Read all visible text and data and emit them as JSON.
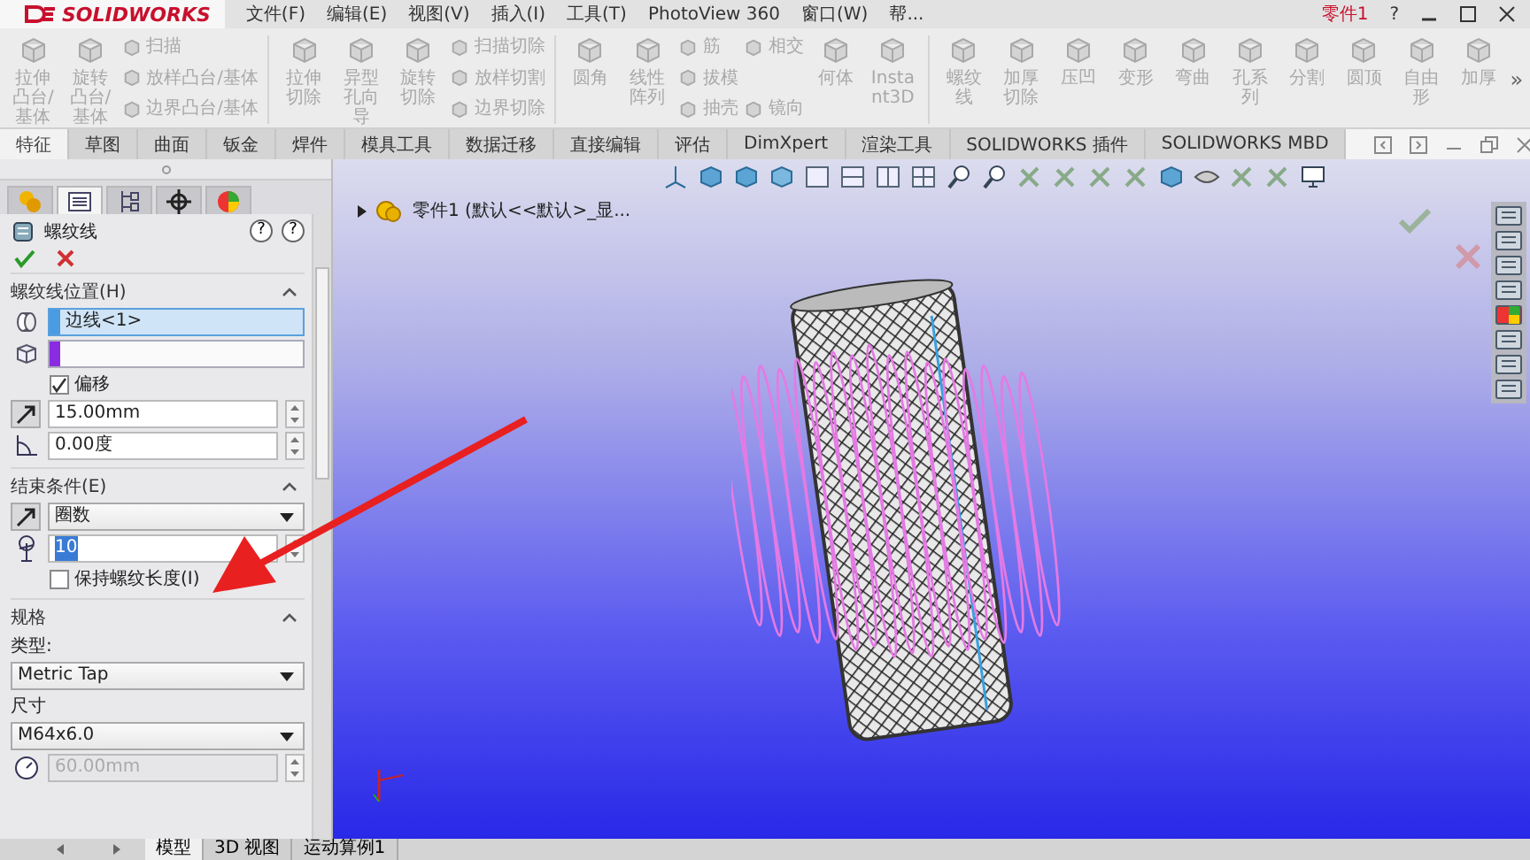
{
  "app": {
    "logo": "SOLIDWORKS",
    "menus": [
      "文件(F)",
      "编辑(E)",
      "视图(V)",
      "插入(I)",
      "工具(T)",
      "PhotoView 360",
      "窗口(W)",
      "帮..."
    ],
    "document": "零件1",
    "help": "?"
  },
  "ribbon": {
    "disabled": true,
    "groups": [
      [
        {
          "kind": "large",
          "label": "拉伸凸台/基体"
        },
        {
          "kind": "large",
          "label": "旋转凸台/基体"
        },
        {
          "kind": "stack",
          "items": [
            "扫描",
            "放样凸台/基体",
            "边界凸台/基体"
          ]
        }
      ],
      [
        {
          "kind": "large",
          "label": "拉伸切除"
        },
        {
          "kind": "large",
          "label": "异型孔向导"
        },
        {
          "kind": "large",
          "label": "旋转切除"
        },
        {
          "kind": "stack",
          "items": [
            "扫描切除",
            "放样切割",
            "边界切除"
          ]
        }
      ],
      [
        {
          "kind": "large",
          "label": "圆角"
        },
        {
          "kind": "large",
          "label": "线性阵列"
        },
        {
          "kind": "stack",
          "items": [
            "筋",
            "拔模",
            "抽壳"
          ]
        },
        {
          "kind": "stack",
          "items": [
            "相交",
            "镜向"
          ]
        },
        {
          "kind": "large",
          "label": "何体"
        },
        {
          "kind": "large",
          "label": "Instant3D"
        }
      ],
      [
        {
          "kind": "large",
          "label": "螺纹线"
        },
        {
          "kind": "large",
          "label": "加厚切除"
        },
        {
          "kind": "large",
          "label": "压凹"
        },
        {
          "kind": "large",
          "label": "变形"
        },
        {
          "kind": "large",
          "label": "弯曲"
        },
        {
          "kind": "large",
          "label": "孔系列"
        },
        {
          "kind": "large",
          "label": "分割"
        },
        {
          "kind": "large",
          "label": "圆顶"
        },
        {
          "kind": "large",
          "label": "自由形"
        },
        {
          "kind": "large",
          "label": "加厚"
        }
      ]
    ],
    "overflow": "»"
  },
  "tabs": [
    {
      "label": "特征",
      "selected": true
    },
    {
      "label": "草图",
      "selected": false
    },
    {
      "label": "曲面",
      "selected": false
    },
    {
      "label": "钣金",
      "selected": false
    },
    {
      "label": "焊件",
      "selected": false
    },
    {
      "label": "模具工具",
      "selected": false
    },
    {
      "label": "数据迁移",
      "selected": false
    },
    {
      "label": "直接编辑",
      "selected": false
    },
    {
      "label": "评估",
      "selected": false
    },
    {
      "label": "DimXpert",
      "selected": false
    },
    {
      "label": "渲染工具",
      "selected": false
    },
    {
      "label": "SOLIDWORKS 插件",
      "selected": false
    },
    {
      "label": "SOLIDWORKS MBD",
      "selected": false
    }
  ],
  "panel": {
    "tabs": [
      {
        "selected": false
      },
      {
        "selected": true
      },
      {
        "selected": false
      },
      {
        "selected": false
      },
      {
        "selected": false
      }
    ],
    "title": "螺纹线",
    "help": [
      "?",
      "?"
    ],
    "sections": [
      {
        "title": "螺纹线位置(H)",
        "expanded": true,
        "rows": [
          {
            "kind": "edge-selection",
            "value": "边线<1>",
            "color": "#4a9be0",
            "selected": true
          },
          {
            "kind": "face-selection",
            "color": "#8a2be2",
            "selected": false
          },
          {
            "kind": "checkbox",
            "label": "偏移",
            "checked": true
          },
          {
            "kind": "distance",
            "value": "15.00mm",
            "disabled": false
          },
          {
            "kind": "angle",
            "value": "0.00度",
            "disabled": false
          }
        ]
      },
      {
        "title": "结束条件(E)",
        "expanded": true,
        "rows": [
          {
            "kind": "end-dropdown",
            "value": "圈数"
          },
          {
            "kind": "revolutions",
            "value": "10",
            "selected": true,
            "disabled": false
          },
          {
            "kind": "checkbox",
            "label": "保持螺纹长度(I)",
            "checked": false
          }
        ]
      },
      {
        "title": "规格",
        "expanded": true,
        "rows": [
          {
            "kind": "label",
            "text": "类型:"
          },
          {
            "kind": "dropdown",
            "value": "Metric Tap"
          },
          {
            "kind": "label",
            "text": "尺寸"
          },
          {
            "kind": "dropdown",
            "value": "M64x6.0"
          },
          {
            "kind": "diameter",
            "value": "60.00mm",
            "disabled": true
          }
        ]
      }
    ]
  },
  "viewport": {
    "tree_item": "零件1  (默认<<默认>_显..."
  },
  "bottom_tabs": [
    {
      "label": "模型",
      "selected": true
    },
    {
      "label": "3D 视图",
      "selected": false
    },
    {
      "label": "运动算例1",
      "selected": false
    }
  ]
}
